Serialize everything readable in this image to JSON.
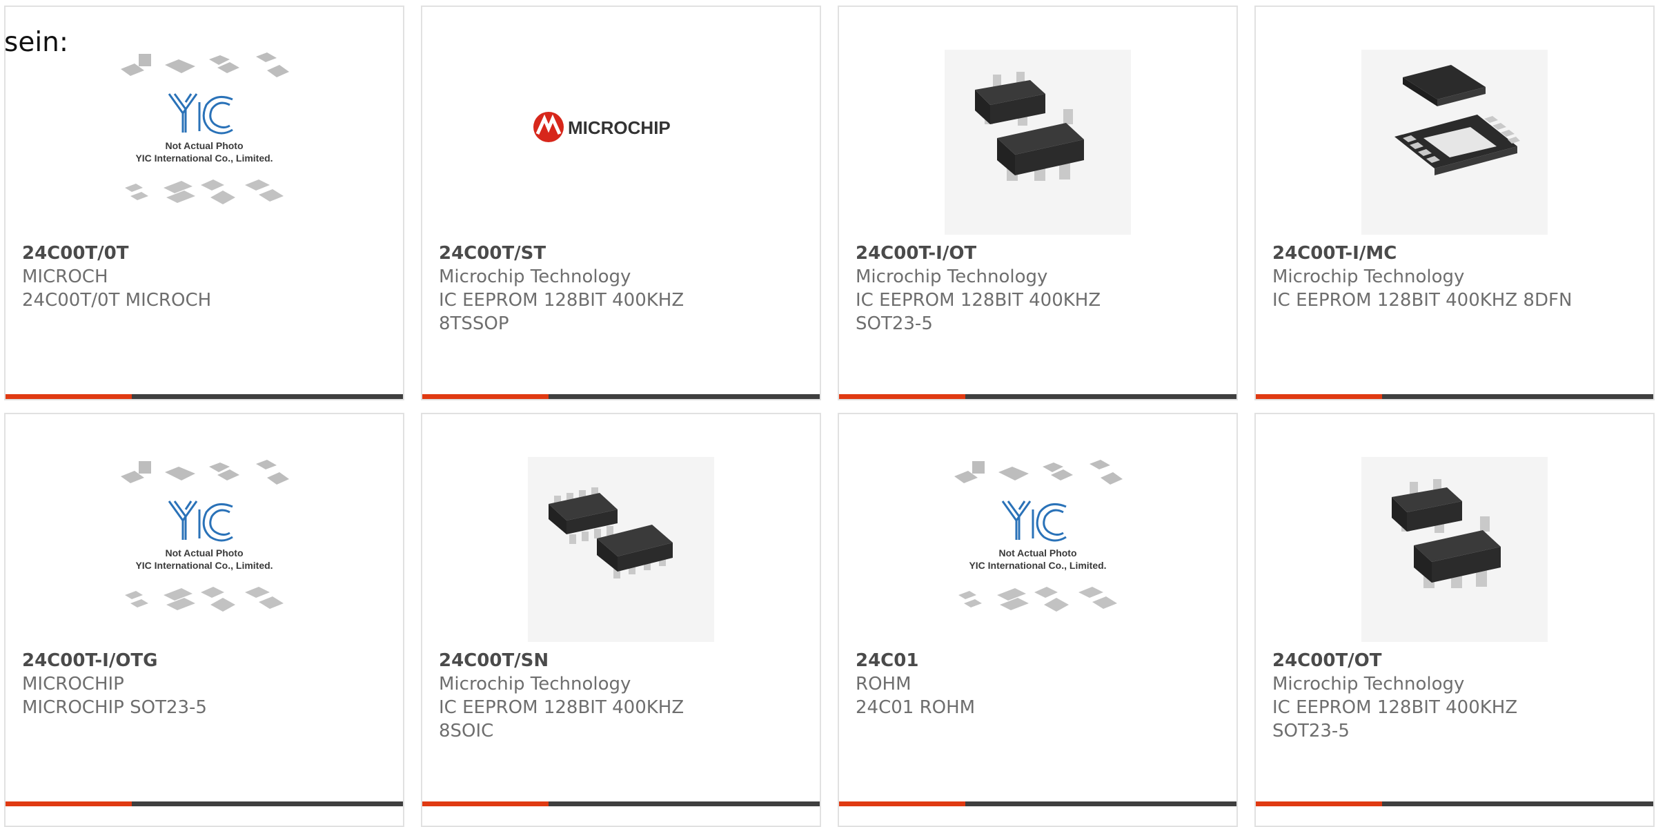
{
  "lead_text": "sein:",
  "products": [
    {
      "part": "24C00T/0T",
      "maker": "MICROCH",
      "desc": [
        "24C00T/0T MICROCH"
      ],
      "image": "yic-placeholder-icon"
    },
    {
      "part": "24C00T/ST",
      "maker": "Microchip Technology",
      "desc": [
        "IC EEPROM 128BIT 400KHZ",
        "8TSSOP"
      ],
      "image": "microchip-logo-icon"
    },
    {
      "part": "24C00T-I/OT",
      "maker": "Microchip Technology",
      "desc": [
        "IC EEPROM 128BIT 400KHZ",
        "SOT23-5"
      ],
      "image": "sot23-chip-icon"
    },
    {
      "part": "24C00T-I/MC",
      "maker": "Microchip Technology",
      "desc": [
        "IC EEPROM 128BIT 400KHZ 8DFN"
      ],
      "image": "dfn-chip-icon"
    },
    {
      "part": "24C00T-I/OTG",
      "maker": "MICROCHIP",
      "desc": [
        "MICROCHIP SOT23-5"
      ],
      "image": "yic-placeholder-icon"
    },
    {
      "part": "24C00T/SN",
      "maker": "Microchip Technology",
      "desc": [
        "IC EEPROM 128BIT 400KHZ",
        "8SOIC"
      ],
      "image": "soic-chip-icon"
    },
    {
      "part": "24C01",
      "maker": "ROHM",
      "desc": [
        "24C01 ROHM"
      ],
      "image": "yic-placeholder-icon"
    },
    {
      "part": "24C00T/OT",
      "maker": "Microchip Technology",
      "desc": [
        "IC EEPROM 128BIT 400KHZ",
        "SOT23-5"
      ],
      "image": "sot23-chip-icon"
    }
  ],
  "placeholder": {
    "line1": "Not Actual Photo",
    "line2": "YIC International Co., Limited.",
    "logo": "YIC"
  },
  "microchip_logo_text": "MICROCHIP",
  "colors": {
    "accent": "#e03a12",
    "bar": "#3f3f3f",
    "border": "#e1e1e1",
    "text": "#6e6e6e",
    "title": "#4a4a4a",
    "yic_blue": "#2a72b8",
    "chip": "#2b2b2b",
    "lead": "#b9b9b9"
  }
}
